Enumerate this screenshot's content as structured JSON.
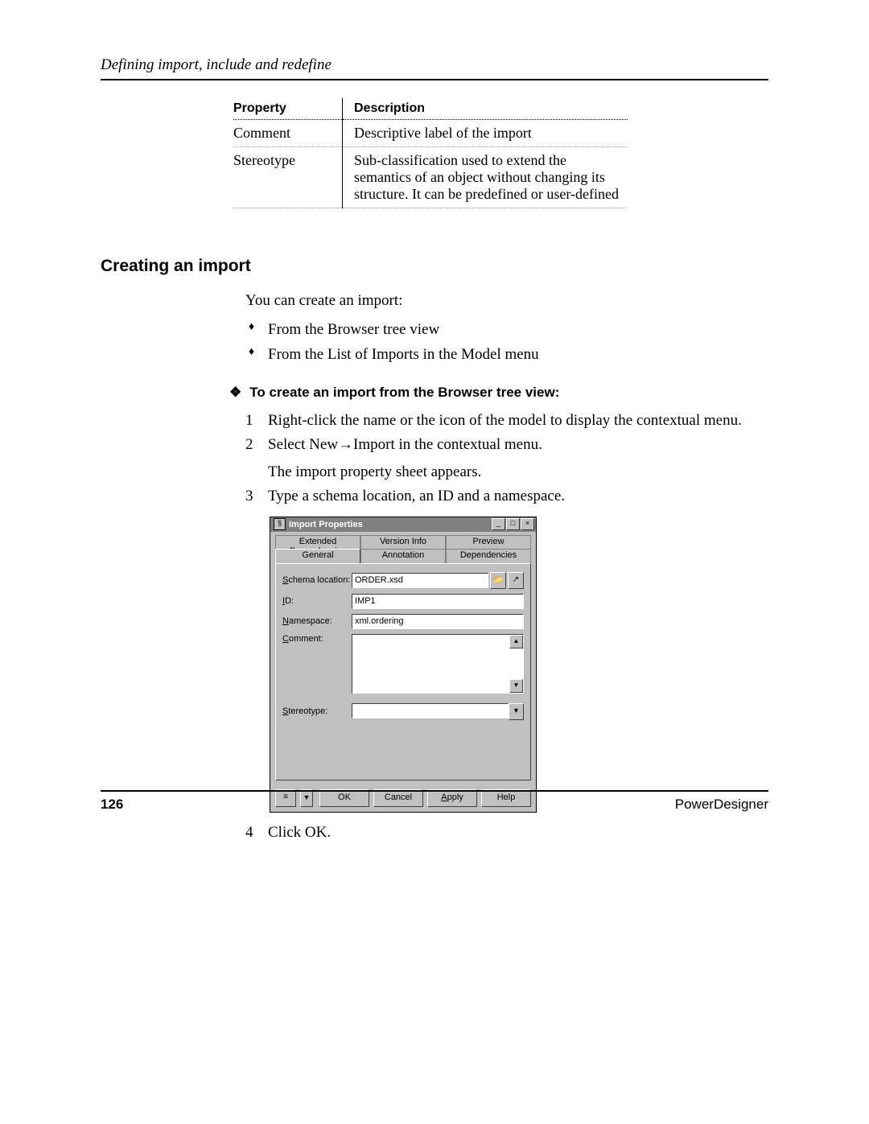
{
  "header": "Defining import, include and redefine",
  "table": {
    "head_prop": "Property",
    "head_desc": "Description",
    "rows": [
      {
        "prop": "Comment",
        "desc": "Descriptive label of the import"
      },
      {
        "prop": "Stereotype",
        "desc": "Sub-classification used to extend the semantics of an object without changing its structure. It can be predefined or user-defined"
      }
    ]
  },
  "section_title": "Creating an import",
  "intro": "You can create an import:",
  "bullets": [
    "From the Browser tree view",
    "From the List of Imports in the Model menu"
  ],
  "subhead": "To create an import from the Browser tree view:",
  "steps": {
    "s1": "Right-click the name or the icon of the model to display the contextual menu.",
    "s2a": "Select New→Import in the contextual menu.",
    "s2b": "The import property sheet appears.",
    "s3": "Type a schema location, an ID and a namespace.",
    "s4": "Click OK."
  },
  "dialog": {
    "title": "Import Properties",
    "tabs_back": [
      "Extended Dependencies",
      "Version Info",
      "Preview"
    ],
    "tabs_front": [
      "General",
      "Annotation",
      "Dependencies"
    ],
    "labels": {
      "schema": "Schema location:",
      "id": "ID:",
      "namespace": "Namespace:",
      "comment": "Comment:",
      "stereotype": "Stereotype:"
    },
    "values": {
      "schema": "ORDER.xsd",
      "id": "IMP1",
      "namespace": "xml.ordering",
      "comment": "",
      "stereotype": ""
    },
    "buttons": {
      "ok": "OK",
      "cancel": "Cancel",
      "apply": "Apply",
      "help": "Help"
    }
  },
  "footer": {
    "page": "126",
    "product": "PowerDesigner"
  }
}
